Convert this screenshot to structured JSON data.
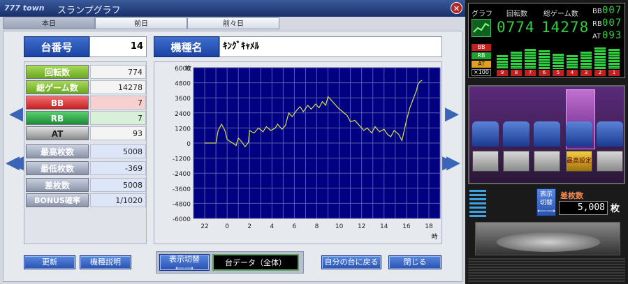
{
  "window": {
    "logo": "777 town",
    "title": "スランプグラフ"
  },
  "tabs": [
    {
      "label": "本日"
    },
    {
      "label": "前日"
    },
    {
      "label": "前々日"
    }
  ],
  "machine_number": {
    "label": "台番号",
    "value": "14"
  },
  "machine_model": {
    "label": "機種名",
    "value": "ｷﾝｸﾞｷｬﾒﾙ"
  },
  "stats": [
    {
      "label": "回転数",
      "value": "774",
      "color": "#7ab828"
    },
    {
      "label": "総ゲーム数",
      "value": "14278",
      "color": "#7ab828"
    },
    {
      "label": "BB",
      "value": "7",
      "color": "#e03a3a"
    },
    {
      "label": "RB",
      "value": "7",
      "color": "#2ea84a"
    },
    {
      "label": "AT",
      "value": "93",
      "color": "#a0a0a0"
    },
    {
      "label": "最高枚数",
      "value": "5008",
      "color": "#a0a8b8"
    },
    {
      "label": "最低枚数",
      "value": "-369",
      "color": "#a0a8b8"
    },
    {
      "label": "差枚数",
      "value": "5008",
      "color": "#a0a8b8"
    },
    {
      "label": "BONUS確率",
      "value": "1/1020",
      "color": "#a0a8b8"
    }
  ],
  "buttons": {
    "update": "更新",
    "model_info": "機種説明",
    "toggle_display": "表示切替",
    "machine_data": "台データ（全体）",
    "back_to_my_machine": "自分の台に戻る",
    "close": "閉じる"
  },
  "chart_data": {
    "type": "line",
    "ylabel": "枚",
    "xlabel": "時",
    "ylim": [
      -6000,
      6000
    ],
    "yticks": [
      6000,
      4800,
      3600,
      2400,
      1200,
      0,
      -1200,
      -2400,
      -3600,
      -4800,
      -6000
    ],
    "xticks": [
      "22",
      "0",
      "2",
      "4",
      "6",
      "8",
      "10",
      "12",
      "14",
      "16",
      "18"
    ],
    "series": [
      {
        "x": [
          22.0,
          23.0,
          23.2,
          23.5,
          23.8,
          24.0,
          24.3,
          24.5,
          24.8,
          25.0,
          25.3,
          25.6,
          25.9,
          26.0,
          26.4,
          26.8,
          27.2,
          27.5,
          27.9,
          28.3,
          28.5,
          28.9,
          29.2,
          29.5,
          29.8,
          30.2,
          30.5,
          30.8,
          31.2,
          31.5,
          31.9,
          32.2,
          32.5,
          32.8,
          33.0,
          33.3,
          33.6,
          33.9,
          34.3,
          34.7,
          35.0,
          35.4,
          35.8,
          36.2,
          36.5,
          36.9,
          37.2,
          37.6,
          38.0,
          38.3,
          38.6,
          38.9,
          39.3,
          39.6,
          40.0,
          40.3,
          40.6,
          40.9,
          41.0,
          41.2,
          41.4
        ],
        "y": [
          0,
          0,
          1000,
          1500,
          1000,
          300,
          100,
          0,
          -200,
          400,
          100,
          -300,
          50,
          1000,
          800,
          1200,
          900,
          1300,
          1000,
          1200,
          1500,
          1100,
          1400,
          2400,
          2100,
          2600,
          2900,
          2500,
          3000,
          2700,
          3100,
          2800,
          3300,
          3000,
          3700,
          3400,
          3100,
          2800,
          2500,
          2200,
          1700,
          1800,
          1400,
          1000,
          1200,
          800,
          1300,
          900,
          1100,
          700,
          500,
          1000,
          700,
          200,
          1800,
          2800,
          3500,
          4200,
          4600,
          4900,
          5000
        ]
      }
    ],
    "line_color": "#d8e050",
    "bg_color": "#000080",
    "grid_color": "#5a5aa8"
  },
  "led": {
    "graph_label": "グラフ",
    "spins_label": "回転数",
    "spins_value": "0774",
    "total_label": "総ゲーム数",
    "total_value": "14278",
    "bb_label": "BB",
    "bb_value": "007",
    "rb_label": "RB",
    "rb_value": "007",
    "at_label": "AT",
    "at_value": "093",
    "legend_bb": "BB",
    "legend_rb": "RB",
    "legend_at": "AT",
    "legend_scale": "×100",
    "days": [
      "9",
      "8",
      "7",
      "6",
      "5",
      "4",
      "3",
      "2",
      "1"
    ]
  },
  "machine_display": {
    "badge": "最高設定",
    "counter_label": "差枚数",
    "counter_value": "5,008",
    "counter_unit": "枚",
    "toggle_label": "表示切替"
  }
}
